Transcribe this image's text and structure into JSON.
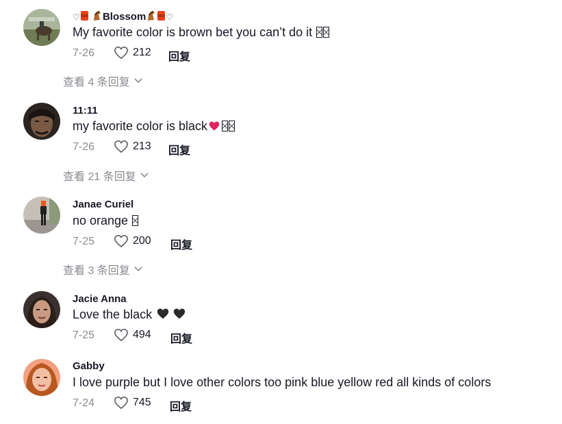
{
  "comments": [
    {
      "username": "Blossom",
      "text": "My favorite color is brown bet you can’t do it",
      "date": "7-26",
      "likes": "212",
      "reply_label": "回复",
      "view_replies": "查看 4 条回复"
    },
    {
      "username": "11:11",
      "text": "my favorite color is black",
      "date": "7-26",
      "likes": "213",
      "reply_label": "回复",
      "view_replies": "查看 21 条回复"
    },
    {
      "username": "Janae Curiel",
      "text": "no orange",
      "date": "7-25",
      "likes": "200",
      "reply_label": "回复",
      "view_replies": "查看 3 条回复"
    },
    {
      "username": "Jacie Anna",
      "text": "Love the black",
      "date": "7-25",
      "likes": "494",
      "reply_label": "回复"
    },
    {
      "username": "Gabby",
      "text": "I love purple but I love other colors too pink blue yellow red all kinds of colors",
      "date": "7-24",
      "likes": "745",
      "reply_label": "回复"
    }
  ],
  "icons": {
    "like": "heart-outline-icon",
    "expand": "chevron-down-icon"
  },
  "colors": {
    "text": "#161823",
    "secondary": "#8a8b91"
  }
}
